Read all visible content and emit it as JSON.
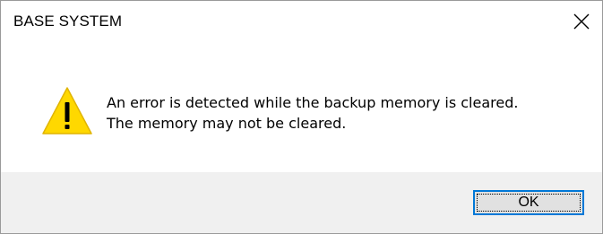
{
  "window": {
    "title": "BASE SYSTEM"
  },
  "icons": {
    "close": "close-icon",
    "warning": "warning-icon"
  },
  "message": {
    "line1": "An error is detected while the backup memory is cleared.",
    "line2": "The memory may not be cleared."
  },
  "buttons": {
    "ok_label": "OK"
  },
  "colors": {
    "accent": "#0078d7",
    "warning_fill": "#ffd800",
    "footer_bg": "#f0f0f0"
  }
}
